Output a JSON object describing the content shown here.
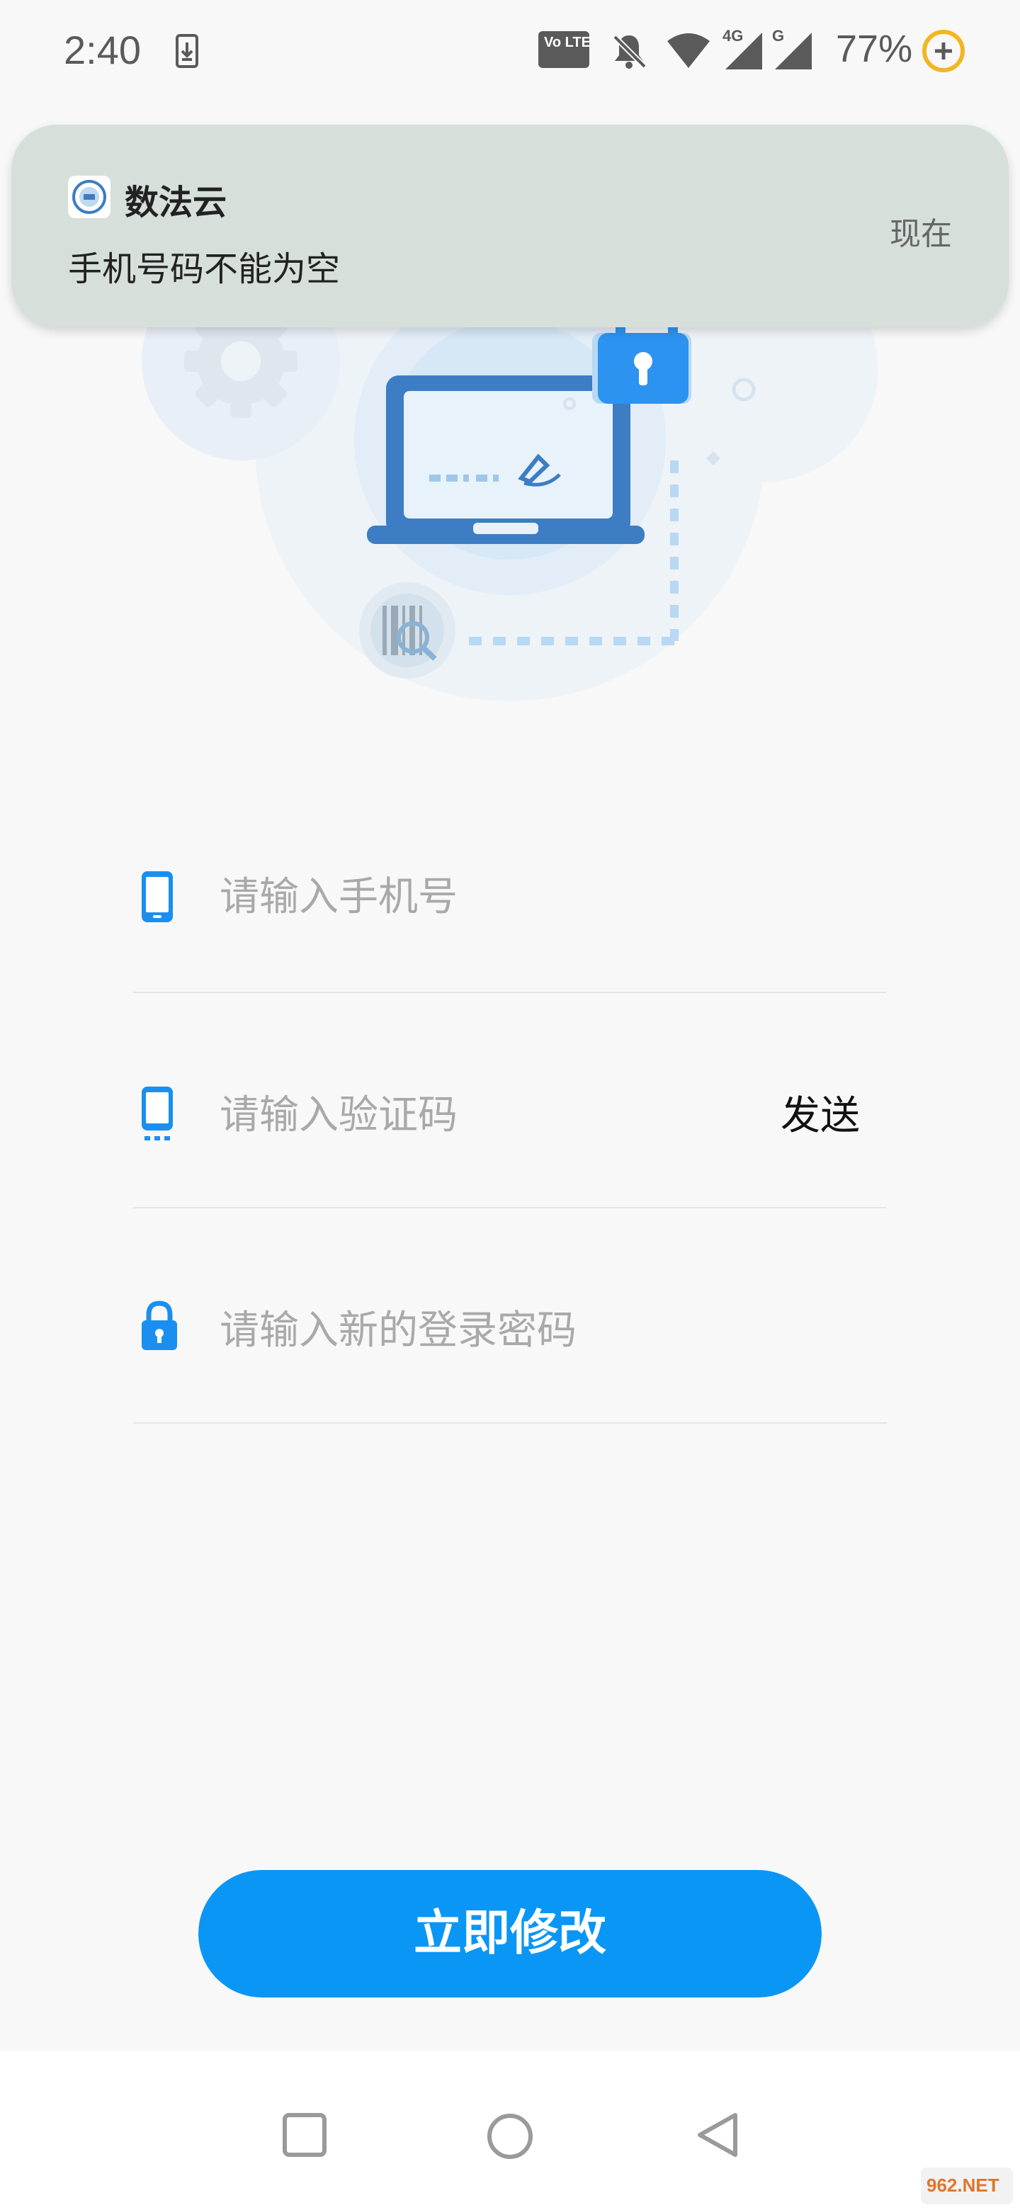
{
  "status_bar": {
    "time": "2:40",
    "battery_percent": "77%",
    "network_label": "4G",
    "network_label_2": "G",
    "volte_label": "Vo LTE 1"
  },
  "notification": {
    "app_name": "数法云",
    "time": "现在",
    "message": "手机号码不能为空"
  },
  "form": {
    "phone": {
      "placeholder": "请输入手机号",
      "value": ""
    },
    "code": {
      "placeholder": "请输入验证码",
      "value": "",
      "send_label": "发送"
    },
    "password": {
      "placeholder": "请输入新的登录密码",
      "value": ""
    }
  },
  "submit": {
    "label": "立即修改"
  },
  "watermark": {
    "text": "962.NET"
  },
  "colors": {
    "accent": "#0a96f5",
    "illustration_primary": "#3c7dc4",
    "notification_bg": "#d7dfdb"
  },
  "icons": {
    "phone_field": "mobile-phone-icon",
    "code_field": "mobile-sms-icon",
    "password_field": "lock-icon"
  }
}
